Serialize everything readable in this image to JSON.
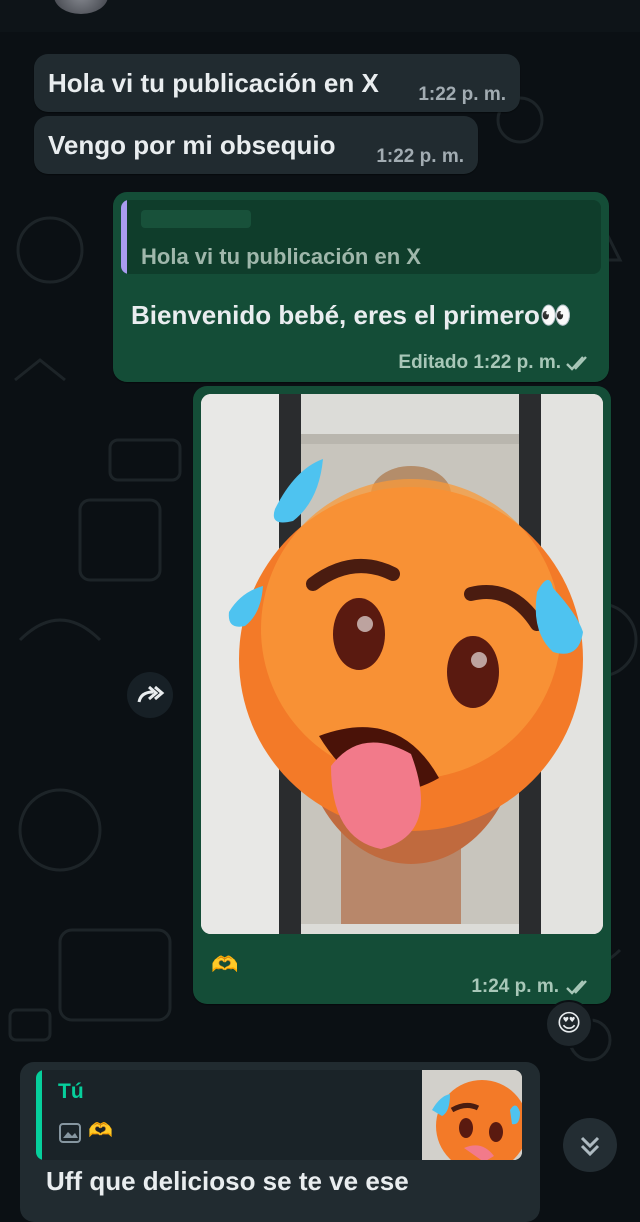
{
  "messages": {
    "m1": {
      "text": "Hola vi tu publicación en X",
      "time": "1:22 p. m."
    },
    "m2": {
      "text": "Vengo por mi obsequio",
      "time": "1:22 p. m."
    },
    "m3": {
      "quoted_text": "Hola vi tu publicación en X",
      "text": "Bienvenido bebé, eres el primero👀",
      "edited_time": "Editado 1:22 p. m."
    },
    "m4": {
      "reaction": "🫶",
      "time": "1:24 p. m.",
      "react_emoji": "😍"
    },
    "reply": {
      "name": "Tú",
      "reaction": "🫶",
      "text": "Uff que delicioso se te ve ese"
    }
  },
  "colors": {
    "incoming": "#212b30",
    "outgoing": "#144d37",
    "accent": "#06cf9c",
    "quote_bar": "#a99cf0"
  },
  "icons": [
    "forward-icon",
    "read-ticks-icon",
    "scroll-down-icon",
    "image-icon"
  ]
}
